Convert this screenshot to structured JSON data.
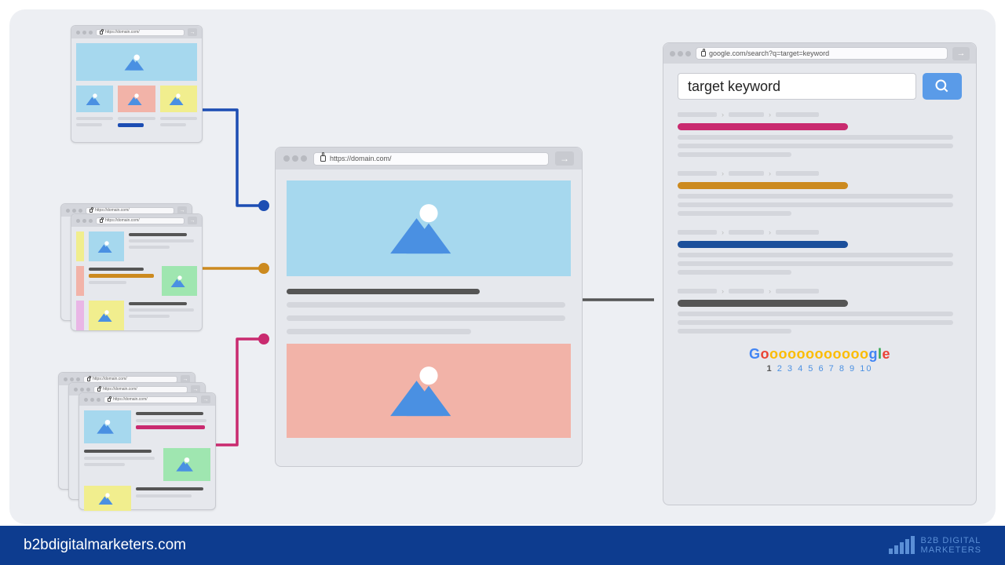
{
  "center": {
    "url": "https://domain.com/"
  },
  "serp": {
    "url": "google.com/search?q=target=keyword",
    "query": "target keyword",
    "logo": {
      "G": "G",
      "ooo": "ooooooooooo",
      "g": "g",
      "l": "l",
      "e": "e"
    },
    "pages": [
      "1",
      "2",
      "3",
      "4",
      "5",
      "6",
      "7",
      "8",
      "9",
      "10"
    ]
  },
  "sources": {
    "s1_url": "https://domain.com/",
    "s2a_url": "https://domain.com/",
    "s2b_url": "https://domain.com/",
    "s3a_url": "https://domain.com/",
    "s3b_url": "https://domain.com/",
    "s3c_url": "https://domain.com/"
  },
  "footer": {
    "domain": "b2bdigitalmarketers.com",
    "brand_line1": "B2B DIGITAL",
    "brand_line2": "MARKETERS"
  },
  "colors": {
    "blue": "#1c4db3",
    "orange": "#cc8a1f",
    "magenta": "#c92a6f",
    "darkblue": "#1b4f9b",
    "grey": "#555555"
  }
}
